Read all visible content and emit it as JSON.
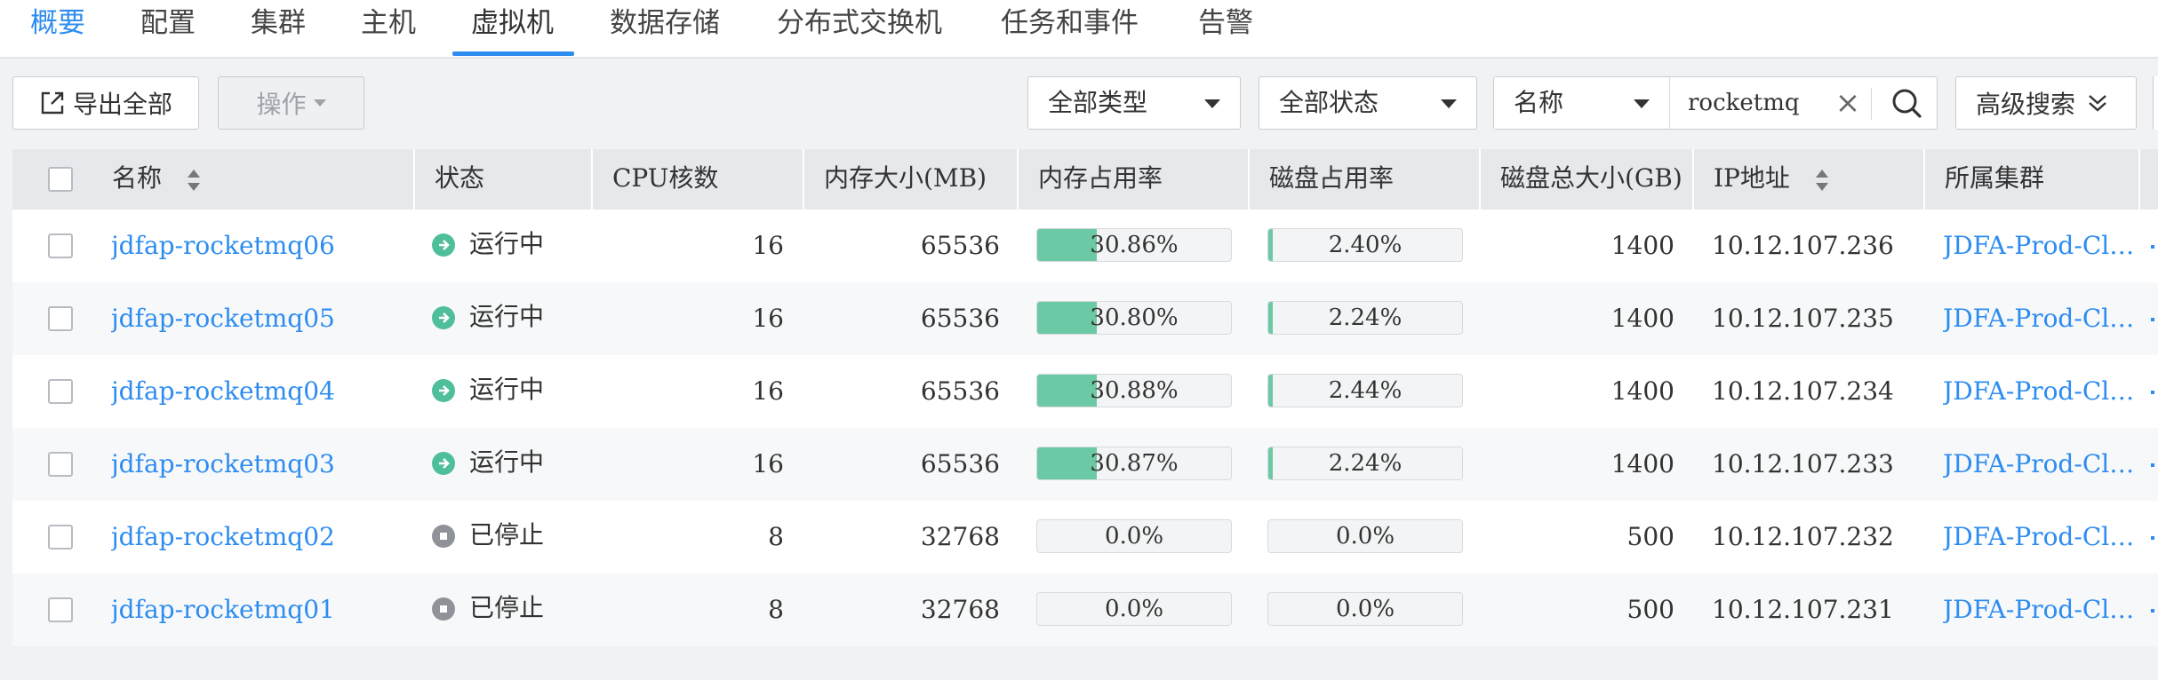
{
  "tabs": [
    {
      "label": "概要"
    },
    {
      "label": "配置"
    },
    {
      "label": "集群"
    },
    {
      "label": "主机"
    },
    {
      "label": "虚拟机"
    },
    {
      "label": "数据存储"
    },
    {
      "label": "分布式交换机"
    },
    {
      "label": "任务和事件"
    },
    {
      "label": "告警"
    }
  ],
  "active_tab": "虚拟机",
  "toolbar": {
    "export_label": "导出全部",
    "operation_label": "操作",
    "type_filter": "全部类型",
    "status_filter": "全部状态",
    "search_field": "名称",
    "search_value": "rocketmq",
    "advanced_label": "高级搜索"
  },
  "table": {
    "headers": {
      "name": "名称",
      "status": "状态",
      "cpu": "CPU核数",
      "memory": "内存大小(MB)",
      "mem_usage": "内存占用率",
      "disk_usage": "磁盘占用率",
      "disk_total": "磁盘总大小(GB)",
      "ip": "IP地址",
      "cluster": "所属集群"
    },
    "rows": [
      {
        "name": "jdfap-rocketmq06",
        "status": "运行中",
        "cpu": "16",
        "memory": "65536",
        "mem_usage": "30.86%",
        "disk_usage": "2.40%",
        "disk_total": "1400",
        "ip": "10.12.107.236",
        "cluster": "JDFA-Prod-Cl…"
      },
      {
        "name": "jdfap-rocketmq05",
        "status": "运行中",
        "cpu": "16",
        "memory": "65536",
        "mem_usage": "30.80%",
        "disk_usage": "2.24%",
        "disk_total": "1400",
        "ip": "10.12.107.235",
        "cluster": "JDFA-Prod-Cl…"
      },
      {
        "name": "jdfap-rocketmq04",
        "status": "运行中",
        "cpu": "16",
        "memory": "65536",
        "mem_usage": "30.88%",
        "disk_usage": "2.44%",
        "disk_total": "1400",
        "ip": "10.12.107.234",
        "cluster": "JDFA-Prod-Cl…"
      },
      {
        "name": "jdfap-rocketmq03",
        "status": "运行中",
        "cpu": "16",
        "memory": "65536",
        "mem_usage": "30.87%",
        "disk_usage": "2.24%",
        "disk_total": "1400",
        "ip": "10.12.107.233",
        "cluster": "JDFA-Prod-Cl…"
      },
      {
        "name": "jdfap-rocketmq02",
        "status": "已停止",
        "cpu": "8",
        "memory": "32768",
        "mem_usage": "0.0%",
        "disk_usage": "0.0%",
        "disk_total": "500",
        "ip": "10.12.107.232",
        "cluster": "JDFA-Prod-Cl…"
      },
      {
        "name": "jdfap-rocketmq01",
        "status": "已停止",
        "cpu": "8",
        "memory": "32768",
        "mem_usage": "0.0%",
        "disk_usage": "0.0%",
        "disk_total": "500",
        "ip": "10.12.107.231",
        "cluster": "JDFA-Prod-Cl…"
      }
    ]
  },
  "colors": {
    "accent": "#2d8cf0",
    "running": "#4fbf9b",
    "stopped": "#8f9399",
    "bar_fill": "#6cc9a5"
  }
}
